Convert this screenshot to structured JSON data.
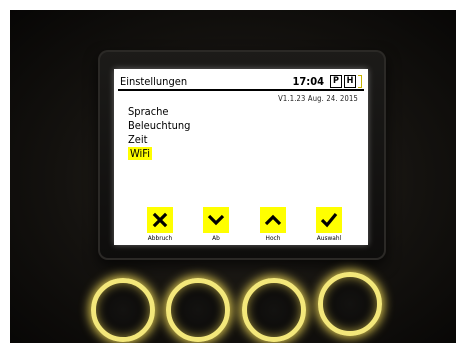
{
  "screen": {
    "title": "Einstellungen",
    "time": "17:04",
    "mode_p": "P",
    "mode_h": "H",
    "version": "V1.1.23  Aug. 24. 2015"
  },
  "menu": {
    "items": [
      {
        "label": "Sprache",
        "selected": false
      },
      {
        "label": "Beleuchtung",
        "selected": false
      },
      {
        "label": "Zeit",
        "selected": false
      },
      {
        "label": "WiFi",
        "selected": true
      }
    ]
  },
  "softkeys": [
    {
      "label": "Abbruch",
      "icon": "close-icon"
    },
    {
      "label": "Ab",
      "icon": "chevron-down-icon"
    },
    {
      "label": "Hoch",
      "icon": "chevron-up-icon"
    },
    {
      "label": "Auswahl",
      "icon": "check-icon"
    }
  ],
  "colors": {
    "highlight": "#ffff00",
    "button_ring": "#f3e77a"
  }
}
